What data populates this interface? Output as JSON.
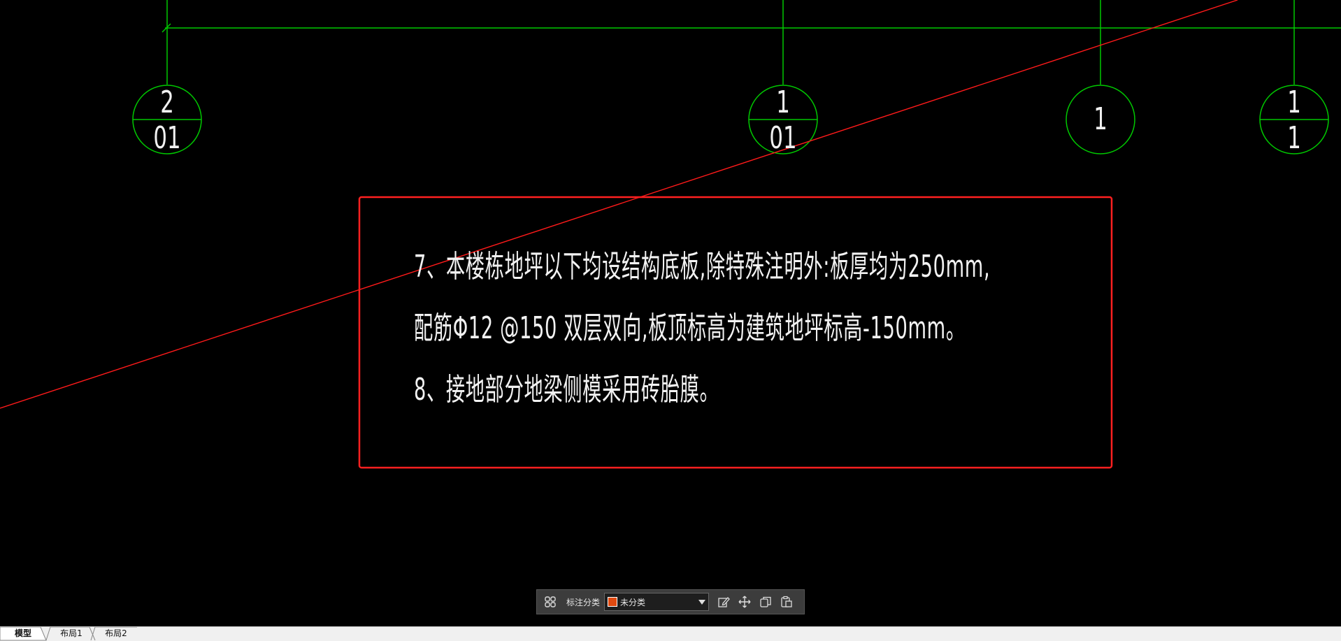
{
  "colors": {
    "background": "#000000",
    "axis_line": "#00c800",
    "red_line": "#ff1a1a",
    "annotation_box": "#ff2020",
    "text": "#f2f2f2"
  },
  "axis_bubbles": [
    {
      "top": "2",
      "bottom": "01",
      "split": true
    },
    {
      "top": "1",
      "bottom": "01",
      "split": true
    },
    {
      "top": "1",
      "bottom": "",
      "split": false
    },
    {
      "top": "1",
      "bottom": "1",
      "split": true
    }
  ],
  "notes": {
    "line1": "7、本楼栋地坪以下均设结构底板,除特殊注明外:板厚均为250mm,",
    "line2": "配筋Φ12 @150 双层双向,板顶标高为建筑地坪标高-150mm。",
    "line3": "8、接地部分地梁侧模采用砖胎膜。"
  },
  "toolbar": {
    "grid_icon": "grid-icon",
    "category_label": "标注分类",
    "category_value": "未分类",
    "category_color": "#e04a10",
    "edit_icon": "edit-icon",
    "move_icon": "move-icon",
    "copy_icon": "copy-icon",
    "paste_icon": "paste-icon"
  },
  "tabs": [
    {
      "label": "模型",
      "active": true
    },
    {
      "label": "布局1",
      "active": false
    },
    {
      "label": "布局2",
      "active": false
    }
  ]
}
